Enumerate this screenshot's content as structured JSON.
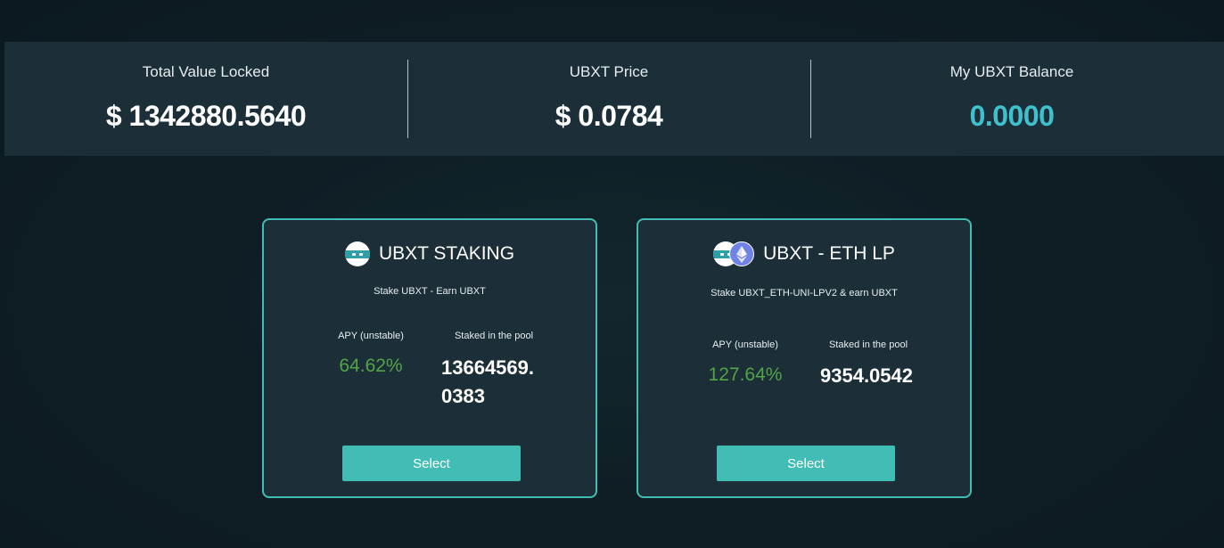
{
  "stats": {
    "tvl_label": "Total Value Locked",
    "tvl_value": "$ 1342880.5640",
    "price_label": "UBXT Price",
    "price_value": "$ 0.0784",
    "balance_label": "My UBXT Balance",
    "balance_value": "0.0000"
  },
  "pools": [
    {
      "title": "UBXT STAKING",
      "subtitle": "Stake UBXT - Earn UBXT",
      "apy_label": "APY (unstable)",
      "apy_value": "64.62%",
      "staked_label": "Staked in the pool",
      "staked_value_line1": "13664569.",
      "staked_value_line2": "0383",
      "button_label": "Select",
      "icon": "ubxt-coin-icon"
    },
    {
      "title": "UBXT - ETH LP",
      "subtitle": "Stake UBXT_ETH-UNI-LPV2 & earn UBXT",
      "apy_label": "APY (unstable)",
      "apy_value": "127.64%",
      "staked_label": "Staked in the pool",
      "staked_value": "9354.0542",
      "button_label": "Select",
      "icon": "ubxt-eth-pair-icon"
    }
  ],
  "colors": {
    "accent": "#42bdb6",
    "balance": "#3ec1cd",
    "apy": "#52a446",
    "panel": "#1c2f38",
    "background": "#0f1e25"
  }
}
